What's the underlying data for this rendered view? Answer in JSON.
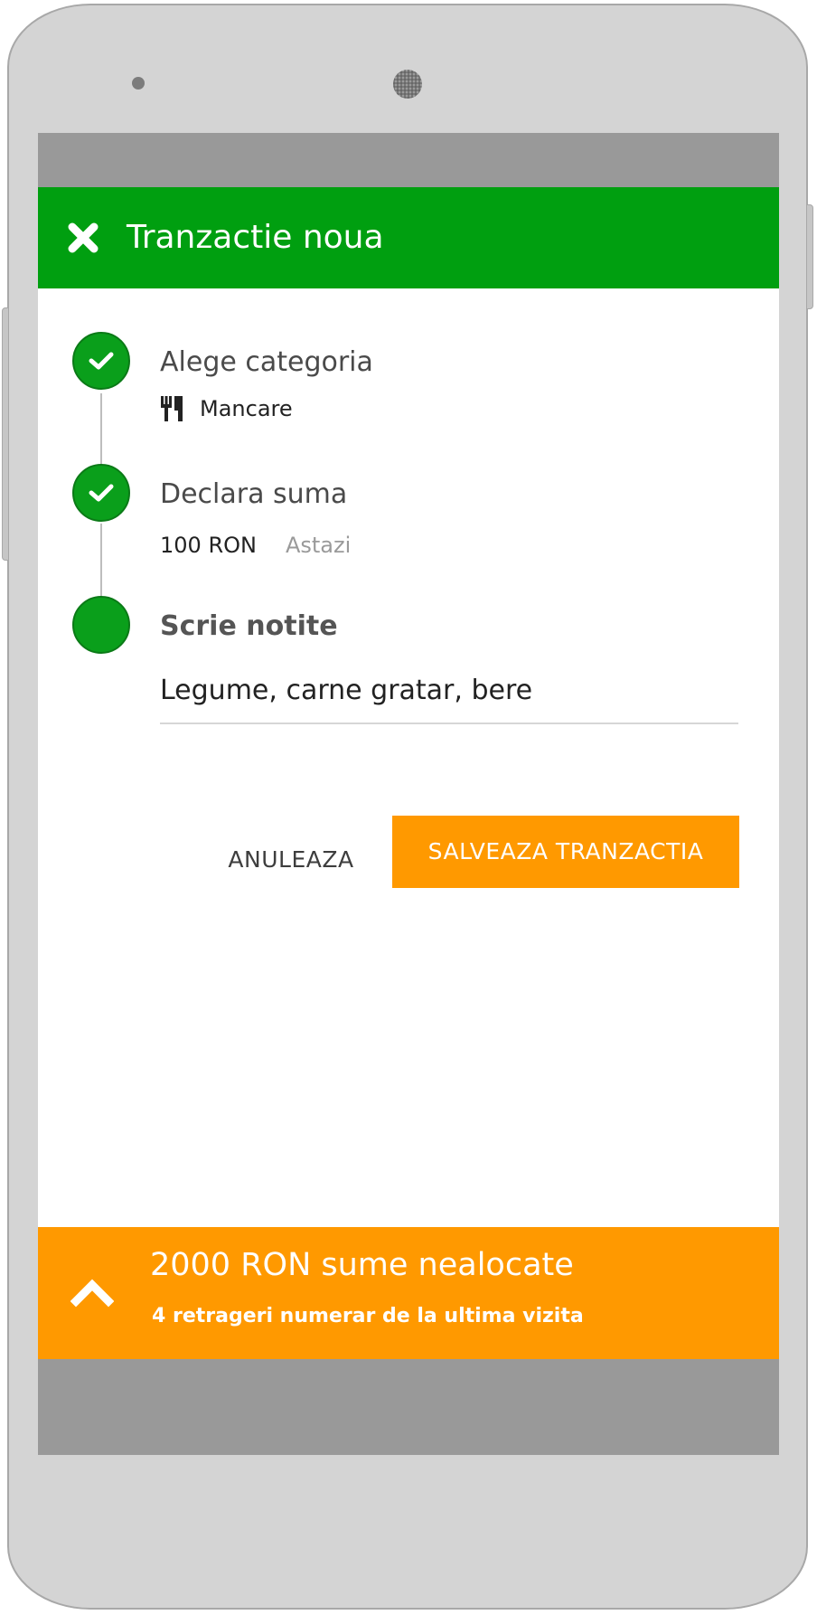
{
  "app_bar": {
    "title": "Tranzactie noua",
    "close_icon": "close-icon",
    "color": "#009f10"
  },
  "steps": [
    {
      "title": "Alege categoria",
      "status": "completed",
      "icon": "check-icon",
      "detail_icon": "fork-knife-icon",
      "detail": "Mancare"
    },
    {
      "title": "Declara suma",
      "status": "completed",
      "icon": "check-icon",
      "amount": "100 RON",
      "date": "Astazi"
    },
    {
      "title": "Scrie notite",
      "status": "active"
    }
  ],
  "notes": {
    "value": "Legume, carne gratar, bere"
  },
  "actions": {
    "cancel_label": "ANULEAZA",
    "save_label": "SALVEAZA TRANZACTIA",
    "save_color": "#ff9900"
  },
  "bottom_sheet": {
    "title": "2000 RON sume nealocate",
    "subtitle": "4 retrageri numerar de la ultima vizita",
    "icon": "chevron-up-icon",
    "color": "#ff9900"
  },
  "system_bars_color": "#999999"
}
